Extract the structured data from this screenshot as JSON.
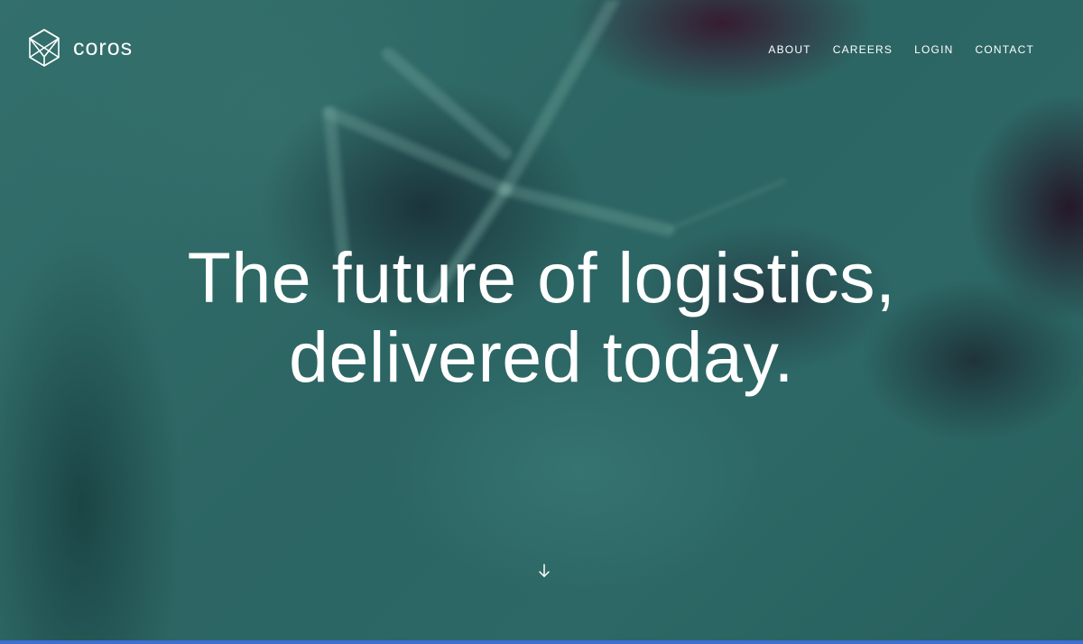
{
  "brand": {
    "name": "coros",
    "logo_icon": "hexagon-geometric-icon"
  },
  "nav": {
    "items": [
      {
        "label": "ABOUT"
      },
      {
        "label": "CAREERS"
      },
      {
        "label": "LOGIN"
      },
      {
        "label": "CONTACT"
      }
    ]
  },
  "hero": {
    "headline_line1": "The future of logistics,",
    "headline_line2": "delivered today.",
    "scroll_icon": "arrow-down-icon"
  },
  "colors": {
    "background_teal": "#2e6a68",
    "text": "#ffffff",
    "accent_bar": "#3e6fd1"
  }
}
